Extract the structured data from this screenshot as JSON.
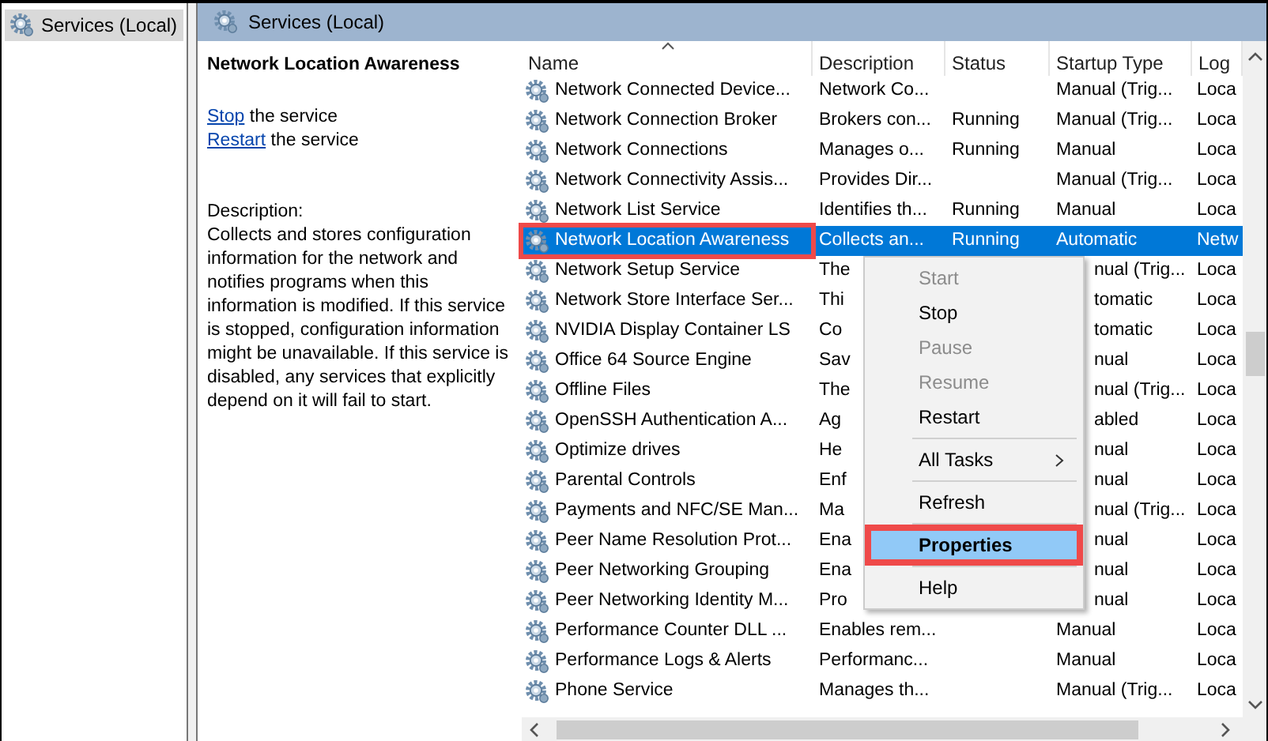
{
  "tree": {
    "items": [
      {
        "label": "Services (Local)",
        "selected": true
      }
    ]
  },
  "panel": {
    "title": "Services (Local)"
  },
  "details": {
    "service_name": "Network Location Awareness",
    "actions": [
      {
        "link": "Stop",
        "text": "the service"
      },
      {
        "link": "Restart",
        "text": "the service"
      }
    ],
    "description_label": "Description:",
    "description": "Collects and stores configuration information for the network and notifies programs when this information is modified. If this service is stopped, configuration information might be unavailable. If this service is disabled, any services that explicitly depend on it will fail to start."
  },
  "table": {
    "columns": [
      "Name",
      "Description",
      "Status",
      "Startup Type",
      "Log"
    ],
    "rows": [
      {
        "name": "Network Connected Device...",
        "description": "Network Co...",
        "status": "",
        "startup": "Manual (Trig...",
        "logon": "Loca",
        "selected": false,
        "covered": false,
        "annotated": false
      },
      {
        "name": "Network Connection Broker",
        "description": "Brokers con...",
        "status": "Running",
        "startup": "Manual (Trig...",
        "logon": "Loca",
        "selected": false,
        "covered": false,
        "annotated": false
      },
      {
        "name": "Network Connections",
        "description": "Manages o...",
        "status": "Running",
        "startup": "Manual",
        "logon": "Loca",
        "selected": false,
        "covered": false,
        "annotated": false
      },
      {
        "name": "Network Connectivity Assis...",
        "description": "Provides Dir...",
        "status": "",
        "startup": "Manual (Trig...",
        "logon": "Loca",
        "selected": false,
        "covered": false,
        "annotated": false
      },
      {
        "name": "Network List Service",
        "description": "Identifies th...",
        "status": "Running",
        "startup": "Manual",
        "logon": "Loca",
        "selected": false,
        "covered": false,
        "annotated": false
      },
      {
        "name": "Network Location Awareness",
        "description": "Collects an...",
        "status": "Running",
        "startup": "Automatic",
        "logon": "Netw",
        "selected": true,
        "covered": false,
        "annotated": true
      },
      {
        "name": "Network Setup Service",
        "description": "The",
        "status": "",
        "startup": "nual (Trig...",
        "logon": "Loca",
        "selected": false,
        "covered": true,
        "annotated": false
      },
      {
        "name": "Network Store Interface Ser...",
        "description": "Thi",
        "status": "",
        "startup": "tomatic",
        "logon": "Loca",
        "selected": false,
        "covered": true,
        "annotated": false
      },
      {
        "name": "NVIDIA Display Container LS",
        "description": "Co",
        "status": "",
        "startup": "tomatic",
        "logon": "Loca",
        "selected": false,
        "covered": true,
        "annotated": false
      },
      {
        "name": "Office 64 Source Engine",
        "description": "Sav",
        "status": "",
        "startup": "nual",
        "logon": "Loca",
        "selected": false,
        "covered": true,
        "annotated": false
      },
      {
        "name": "Offline Files",
        "description": "The",
        "status": "",
        "startup": "nual (Trig...",
        "logon": "Loca",
        "selected": false,
        "covered": true,
        "annotated": false
      },
      {
        "name": "OpenSSH Authentication A...",
        "description": "Ag",
        "status": "",
        "startup": "abled",
        "logon": "Loca",
        "selected": false,
        "covered": true,
        "annotated": false
      },
      {
        "name": "Optimize drives",
        "description": "He",
        "status": "",
        "startup": "nual",
        "logon": "Loca",
        "selected": false,
        "covered": true,
        "annotated": false
      },
      {
        "name": "Parental Controls",
        "description": "Enf",
        "status": "",
        "startup": "nual",
        "logon": "Loca",
        "selected": false,
        "covered": true,
        "annotated": false
      },
      {
        "name": "Payments and NFC/SE Man...",
        "description": "Ma",
        "status": "",
        "startup": "nual (Trig...",
        "logon": "Loca",
        "selected": false,
        "covered": true,
        "annotated": false
      },
      {
        "name": "Peer Name Resolution Prot...",
        "description": "Ena",
        "status": "",
        "startup": "nual",
        "logon": "Loca",
        "selected": false,
        "covered": true,
        "annotated": false
      },
      {
        "name": "Peer Networking Grouping",
        "description": "Ena",
        "status": "",
        "startup": "nual",
        "logon": "Loca",
        "selected": false,
        "covered": true,
        "annotated": false
      },
      {
        "name": "Peer Networking Identity M...",
        "description": "Pro",
        "status": "",
        "startup": "nual",
        "logon": "Loca",
        "selected": false,
        "covered": true,
        "annotated": false
      },
      {
        "name": "Performance Counter DLL ...",
        "description": "Enables rem...",
        "status": "",
        "startup": "Manual",
        "logon": "Loca",
        "selected": false,
        "covered": false,
        "annotated": false
      },
      {
        "name": "Performance Logs & Alerts",
        "description": "Performanc...",
        "status": "",
        "startup": "Manual",
        "logon": "Loca",
        "selected": false,
        "covered": false,
        "annotated": false
      },
      {
        "name": "Phone Service",
        "description": "Manages th...",
        "status": "",
        "startup": "Manual (Trig...",
        "logon": "Loca",
        "selected": false,
        "covered": false,
        "annotated": false
      }
    ]
  },
  "context_menu": {
    "items": [
      {
        "kind": "item",
        "label": "Start",
        "disabled": true,
        "submenu": false,
        "default": false,
        "highlighted": false,
        "annotated": false
      },
      {
        "kind": "item",
        "label": "Stop",
        "disabled": false,
        "submenu": false,
        "default": false,
        "highlighted": false,
        "annotated": false
      },
      {
        "kind": "item",
        "label": "Pause",
        "disabled": true,
        "submenu": false,
        "default": false,
        "highlighted": false,
        "annotated": false
      },
      {
        "kind": "item",
        "label": "Resume",
        "disabled": true,
        "submenu": false,
        "default": false,
        "highlighted": false,
        "annotated": false
      },
      {
        "kind": "item",
        "label": "Restart",
        "disabled": false,
        "submenu": false,
        "default": false,
        "highlighted": false,
        "annotated": false
      },
      {
        "kind": "separator"
      },
      {
        "kind": "item",
        "label": "All Tasks",
        "disabled": false,
        "submenu": true,
        "default": false,
        "highlighted": false,
        "annotated": false
      },
      {
        "kind": "separator"
      },
      {
        "kind": "item",
        "label": "Refresh",
        "disabled": false,
        "submenu": false,
        "default": false,
        "highlighted": false,
        "annotated": false
      },
      {
        "kind": "separator"
      },
      {
        "kind": "item",
        "label": "Properties",
        "disabled": false,
        "submenu": false,
        "default": true,
        "highlighted": true,
        "annotated": true
      },
      {
        "kind": "separator"
      },
      {
        "kind": "item",
        "label": "Help",
        "disabled": false,
        "submenu": false,
        "default": false,
        "highlighted": false,
        "annotated": false
      }
    ]
  }
}
